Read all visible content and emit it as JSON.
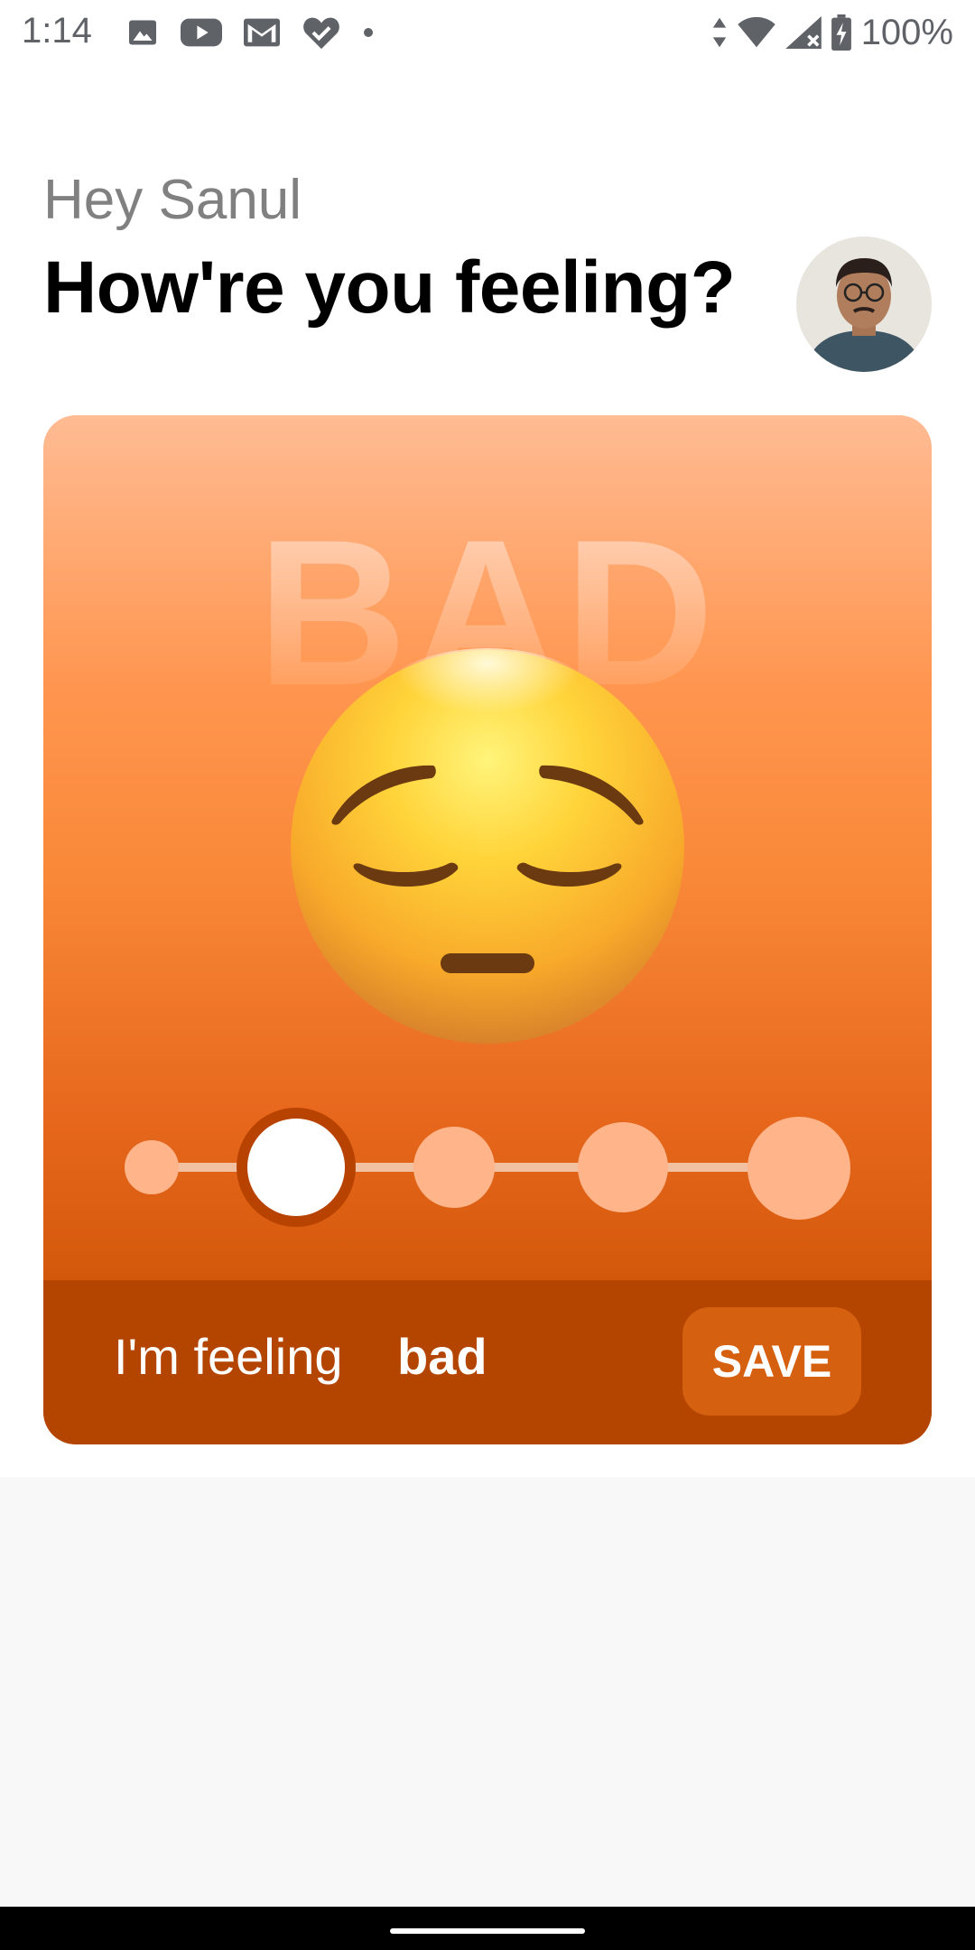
{
  "status_bar": {
    "time": "1:14",
    "battery": "100%",
    "left_icons": [
      "image-icon",
      "youtube-icon",
      "gmail-icon",
      "heart-check-icon",
      "dot-icon"
    ],
    "right_icons": [
      "data-arrows-icon",
      "wifi-icon",
      "signal-icon",
      "battery-charging-icon"
    ]
  },
  "header": {
    "greeting": "Hey Sanul",
    "headline": "How're you feeling?"
  },
  "mood_card": {
    "watermark": "BAD",
    "emoji": "pensive-face-icon",
    "levels_count": 5,
    "selected_level": 2,
    "footer_prefix": "I'm feeling",
    "footer_mood": "bad",
    "save_label": "SAVE"
  },
  "colors": {
    "card_top": "#ffbb93",
    "card_bottom": "#cb5000",
    "footer": "#b44500",
    "save_button": "#d5600f",
    "slider_dot": "#ffb48a",
    "selected_ring": "#b84300"
  }
}
